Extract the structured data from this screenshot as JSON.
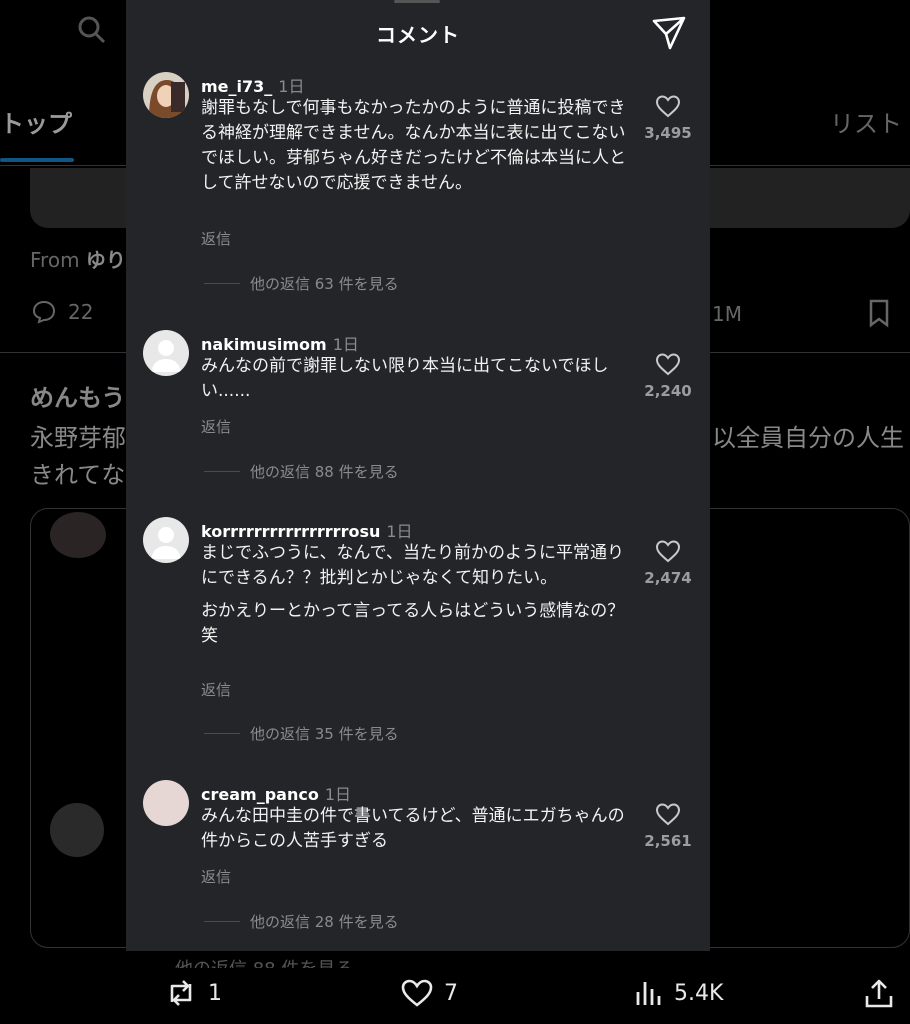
{
  "background": {
    "tab_left": "トップ",
    "tab_right": "リスト",
    "from_label": "From",
    "from_name": "ゆり",
    "reply_count": "22",
    "views_right": "1M",
    "tweet_name": "めんもう",
    "tweet_text_line1": "永野芽郁",
    "tweet_text_line2": "きれてな",
    "tweet_text_right": "以全員自分の人生",
    "more_replies": "他の返信 88 件を見る",
    "actions": {
      "retweets": "1",
      "likes": "7",
      "views": "5.4K"
    }
  },
  "sheet": {
    "title": "コメント",
    "reply_label": "返信",
    "comments": [
      {
        "user": "me_i73_",
        "time": "1日",
        "paragraphs": [
          "謝罪もなしで何事もなかったかのように普通に投稿できる神経が理解できません。なんか本当に表に出てこないでほしい。芽郁ちゃん好きだったけど不倫は本当に人として許せないので応援できません。"
        ],
        "likes": "3,495",
        "more": "他の返信 63 件を見る",
        "avatar_color": "#8a5a3a"
      },
      {
        "user": "nakimusimom",
        "time": "1日",
        "paragraphs": [
          "みんなの前で謝罪しない限り本当に出てこないでほしい......"
        ],
        "likes": "2,240",
        "more": "他の返信 88 件を見る",
        "avatar_color": "#e8e8e8"
      },
      {
        "user": "korrrrrrrrrrrrrrrrosu",
        "time": "1日",
        "paragraphs": [
          "まじでふつうに、なんで、当たり前かのように平常通りにできるん？？批判とかじゃなくて知りたい。",
          "おかえりーとかって言ってる人らはどういう感情なの？笑"
        ],
        "likes": "2,474",
        "more": "他の返信 35 件を見る",
        "avatar_color": "#e8e8e8"
      },
      {
        "user": "cream_panco",
        "time": "1日",
        "paragraphs": [
          "みんな田中圭の件で書いてるけど、普通にエガちゃんの件からこの人苦手すぎる"
        ],
        "likes": "2,561",
        "more": "他の返信 28 件を見る",
        "avatar_color": "#e6d6d4"
      }
    ]
  }
}
